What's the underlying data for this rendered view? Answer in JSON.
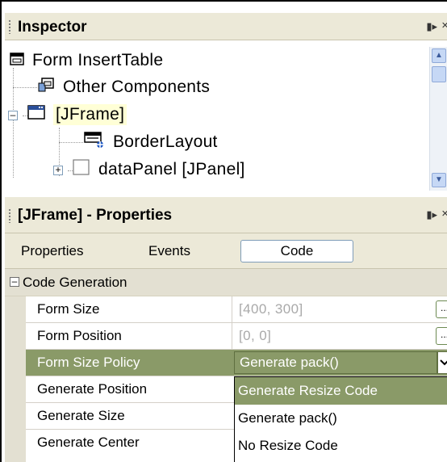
{
  "inspector": {
    "title": "Inspector",
    "tree": [
      {
        "label": "Form InsertTable"
      },
      {
        "label": "Other Components"
      },
      {
        "label": "[JFrame]"
      },
      {
        "label": "BorderLayout"
      },
      {
        "label": "dataPanel [JPanel]"
      }
    ]
  },
  "properties": {
    "title": "[JFrame] - Properties",
    "tabs": [
      "Properties",
      "Events",
      "Code"
    ],
    "active_tab": "Code",
    "section": "Code Generation",
    "rows": [
      {
        "name": "Form Size",
        "value": "[400, 300]"
      },
      {
        "name": "Form Position",
        "value": "[0, 0]"
      },
      {
        "name": "Form Size Policy",
        "value": "Generate pack()"
      },
      {
        "name": "Generate Position",
        "value": ""
      },
      {
        "name": "Generate Size",
        "value": ""
      },
      {
        "name": "Generate Center",
        "value": ""
      }
    ],
    "dropdown": [
      "Generate Resize Code",
      "Generate pack()",
      "No Resize Code"
    ],
    "dropdown_selected": "Generate Resize Code",
    "ellipsis_label": "..."
  },
  "icons": {
    "pin": "pin-icon",
    "close": "close-icon",
    "form": "form-icon",
    "components": "components-icon",
    "frame": "frame-icon",
    "layout": "layout-icon",
    "panel": "panel-icon"
  },
  "colors": {
    "selection": "#8a9a68",
    "highlight": "#ffffd6",
    "header_bg": "#ece9d8"
  }
}
